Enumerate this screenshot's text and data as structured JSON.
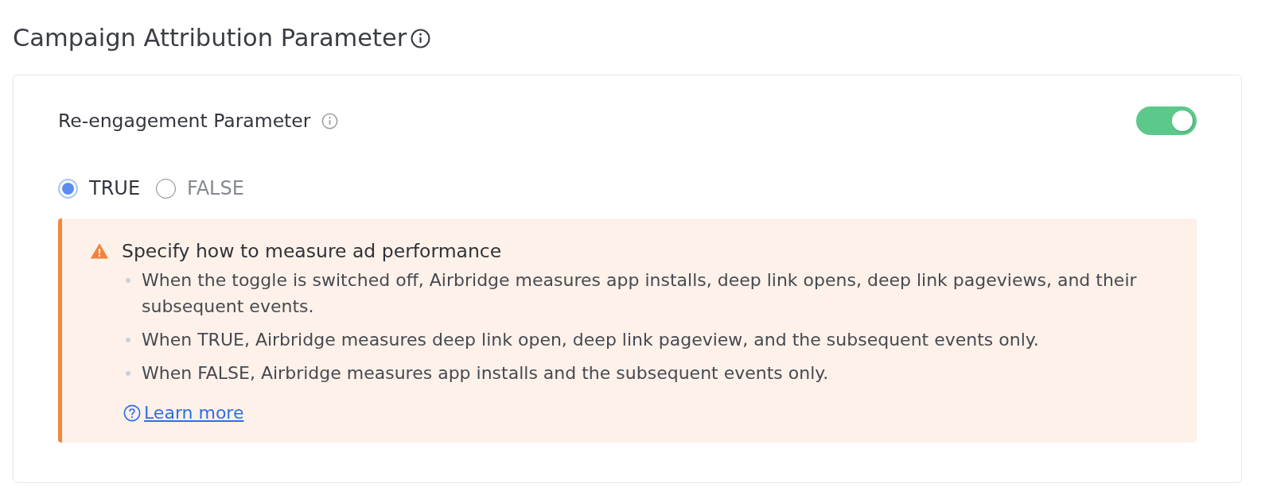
{
  "title": "Campaign Attribution Parameter",
  "setting": {
    "label": "Re-engagement Parameter",
    "on": true
  },
  "options": [
    {
      "label": "TRUE",
      "selected": true
    },
    {
      "label": "FALSE",
      "selected": false
    }
  ],
  "alert": {
    "title": "Specify how to measure ad performance",
    "items": [
      "When the toggle is switched off, Airbridge measures app installs, deep link opens, deep link pageviews, and their subsequent events.",
      "When TRUE, Airbridge measures deep link open, deep link pageview, and the subsequent events only.",
      "When FALSE, Airbridge measures app installs and the subsequent events only."
    ],
    "link": "Learn more"
  }
}
